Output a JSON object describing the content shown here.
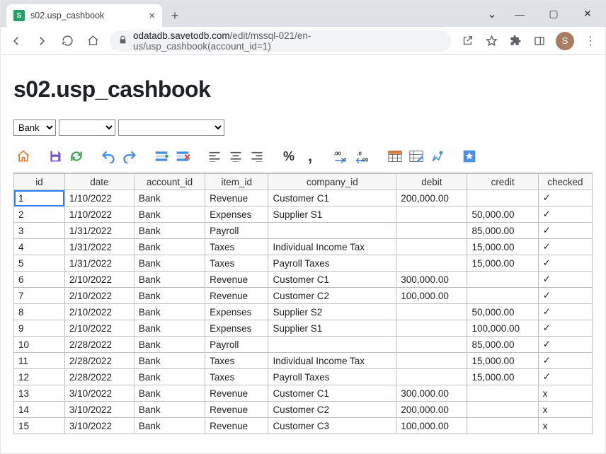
{
  "browser": {
    "tab_title": "s02.usp_cashbook",
    "url_host": "odatadb.savetodb.com",
    "url_path": "/edit/mssql-021/en-us/usp_cashbook(account_id=1)",
    "avatar_letter": "S"
  },
  "page": {
    "title": "s02.usp_cashbook"
  },
  "filters": {
    "sel1": "Bank",
    "sel2": "",
    "sel3": ""
  },
  "toolbar": {
    "percent": "%",
    "comma": ","
  },
  "grid": {
    "headers": {
      "id": "id",
      "date": "date",
      "account_id": "account_id",
      "item_id": "item_id",
      "company_id": "company_id",
      "debit": "debit",
      "credit": "credit",
      "checked": "checked"
    },
    "rows": [
      {
        "id": "1",
        "date": "1/10/2022",
        "account": "Bank",
        "item": "Revenue",
        "company": "Customer C1",
        "debit": "200,000.00",
        "credit": "",
        "checked": "✓"
      },
      {
        "id": "2",
        "date": "1/10/2022",
        "account": "Bank",
        "item": "Expenses",
        "company": "Supplier S1",
        "debit": "",
        "credit": "50,000.00",
        "checked": "✓"
      },
      {
        "id": "3",
        "date": "1/31/2022",
        "account": "Bank",
        "item": "Payroll",
        "company": "",
        "debit": "",
        "credit": "85,000.00",
        "checked": "✓"
      },
      {
        "id": "4",
        "date": "1/31/2022",
        "account": "Bank",
        "item": "Taxes",
        "company": "Individual Income Tax",
        "debit": "",
        "credit": "15,000.00",
        "checked": "✓"
      },
      {
        "id": "5",
        "date": "1/31/2022",
        "account": "Bank",
        "item": "Taxes",
        "company": "Payroll Taxes",
        "debit": "",
        "credit": "15,000.00",
        "checked": "✓"
      },
      {
        "id": "6",
        "date": "2/10/2022",
        "account": "Bank",
        "item": "Revenue",
        "company": "Customer C1",
        "debit": "300,000.00",
        "credit": "",
        "checked": "✓"
      },
      {
        "id": "7",
        "date": "2/10/2022",
        "account": "Bank",
        "item": "Revenue",
        "company": "Customer C2",
        "debit": "100,000.00",
        "credit": "",
        "checked": "✓"
      },
      {
        "id": "8",
        "date": "2/10/2022",
        "account": "Bank",
        "item": "Expenses",
        "company": "Supplier S2",
        "debit": "",
        "credit": "50,000.00",
        "checked": "✓"
      },
      {
        "id": "9",
        "date": "2/10/2022",
        "account": "Bank",
        "item": "Expenses",
        "company": "Supplier S1",
        "debit": "",
        "credit": "100,000.00",
        "checked": "✓"
      },
      {
        "id": "10",
        "date": "2/28/2022",
        "account": "Bank",
        "item": "Payroll",
        "company": "",
        "debit": "",
        "credit": "85,000.00",
        "checked": "✓"
      },
      {
        "id": "11",
        "date": "2/28/2022",
        "account": "Bank",
        "item": "Taxes",
        "company": "Individual Income Tax",
        "debit": "",
        "credit": "15,000.00",
        "checked": "✓"
      },
      {
        "id": "12",
        "date": "2/28/2022",
        "account": "Bank",
        "item": "Taxes",
        "company": "Payroll Taxes",
        "debit": "",
        "credit": "15,000.00",
        "checked": "✓"
      },
      {
        "id": "13",
        "date": "3/10/2022",
        "account": "Bank",
        "item": "Revenue",
        "company": "Customer C1",
        "debit": "300,000.00",
        "credit": "",
        "checked": "x"
      },
      {
        "id": "14",
        "date": "3/10/2022",
        "account": "Bank",
        "item": "Revenue",
        "company": "Customer C2",
        "debit": "200,000.00",
        "credit": "",
        "checked": "x"
      },
      {
        "id": "15",
        "date": "3/10/2022",
        "account": "Bank",
        "item": "Revenue",
        "company": "Customer C3",
        "debit": "100,000.00",
        "credit": "",
        "checked": "x"
      }
    ]
  }
}
